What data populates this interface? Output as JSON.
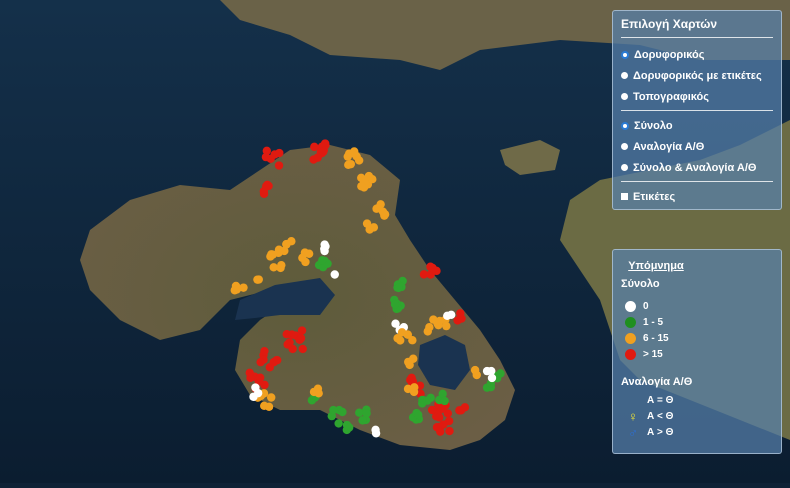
{
  "layers_panel": {
    "title": "Επιλογή Χαρτών",
    "basemaps": [
      {
        "label": "Δορυφορικός",
        "selected": true
      },
      {
        "label": "Δορυφορικός με ετικέτες",
        "selected": false
      },
      {
        "label": "Τοπογραφικός",
        "selected": false
      }
    ],
    "modes": [
      {
        "label": "Σύνολο",
        "selected": true
      },
      {
        "label": "Αναλογία Α/Θ",
        "selected": false
      },
      {
        "label": "Σύνολο & Αναλογία Α/Θ",
        "selected": false
      }
    ],
    "labels_checkbox": {
      "label": "Ετικέτες",
      "checked": false
    }
  },
  "legend": {
    "title": "Υπόμνημα",
    "total_title": "Σύνολο",
    "total_items": [
      {
        "label": "0",
        "color": "#ffffff"
      },
      {
        "label": "1 - 5",
        "color": "#1f8f1f"
      },
      {
        "label": "6 - 15",
        "color": "#f0a020"
      },
      {
        "label": "> 15",
        "color": "#e01a10"
      }
    ],
    "ratio_title": "Αναλογία Α/Θ",
    "ratio_items": [
      {
        "label": "Α = Θ",
        "icon": "none-icon",
        "color": ""
      },
      {
        "label": "Α < Θ",
        "icon": "female-symbol-icon",
        "color": "#f3e633"
      },
      {
        "label": "Α > Θ",
        "icon": "male-symbol-icon",
        "color": "#2b6fd6"
      }
    ]
  },
  "map": {
    "sea_color": "#10263b",
    "land_color": "#5b5a3a",
    "marker_colors": {
      "zero": "#ffffff",
      "low": "#2fa52f",
      "mid": "#f0a020",
      "high": "#e01a10"
    }
  }
}
